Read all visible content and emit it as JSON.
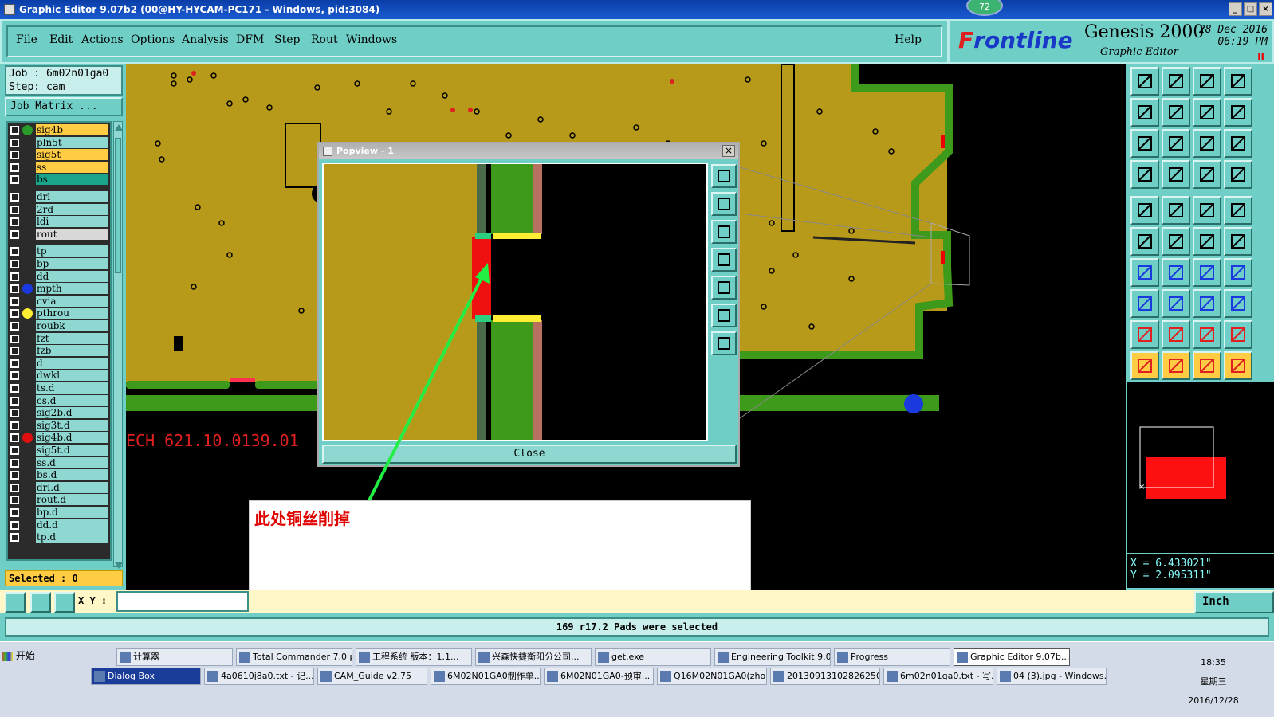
{
  "window": {
    "title": "Graphic Editor 9.07b2 (00@HY-HYCAM-PC171 - Windows, pid:3084)",
    "badge": "72",
    "controls": [
      "_",
      "□",
      "×"
    ]
  },
  "menu": {
    "items": [
      "File",
      "Edit",
      "Actions",
      "Options",
      "Analysis",
      "DFM",
      "Step",
      "Rout",
      "Windows"
    ],
    "help": "Help"
  },
  "brand": {
    "logo_prefix": "F",
    "logo_main": "rontline",
    "product": "Genesis 2000",
    "subtitle": "Graphic Editor",
    "date_line1": "28 Dec 2016",
    "date_line2": "06:19 PM",
    "pause": "II"
  },
  "job": {
    "job_line": "Job : 6m02n01ga0",
    "step_line": "Step: cam",
    "matrix_button": "Job Matrix ...",
    "selected": "Selected : 0"
  },
  "layers": [
    {
      "name": "sig4b",
      "color": "#ffcc44",
      "dot": "#2a9a2a"
    },
    {
      "name": "pln5t",
      "color": "#8fd8d2",
      "dot": ""
    },
    {
      "name": "sig5t",
      "color": "#ffcc44",
      "dot": ""
    },
    {
      "name": "ss",
      "color": "#ffcc44",
      "dot": ""
    },
    {
      "name": "bs",
      "color": "#1aa58a",
      "dot": ""
    },
    {
      "name": "drl",
      "color": "#8fd8d2",
      "dot": ""
    },
    {
      "name": "2rd",
      "color": "#8fd8d2",
      "dot": ""
    },
    {
      "name": "ldi",
      "color": "#8fd8d2",
      "dot": ""
    },
    {
      "name": "rout",
      "color": "#d8d8d8",
      "dot": ""
    },
    {
      "name": "tp",
      "color": "#8fd8d2",
      "dot": ""
    },
    {
      "name": "bp",
      "color": "#8fd8d2",
      "dot": ""
    },
    {
      "name": "dd",
      "color": "#8fd8d2",
      "dot": ""
    },
    {
      "name": "mpth",
      "color": "#8fd8d2",
      "dot": "#1a3ae0"
    },
    {
      "name": "cvia",
      "color": "#8fd8d2",
      "dot": ""
    },
    {
      "name": "pthrou",
      "color": "#8fd8d2",
      "dot": "#ffee33"
    },
    {
      "name": "roubk",
      "color": "#8fd8d2",
      "dot": ""
    },
    {
      "name": "fzt",
      "color": "#8fd8d2",
      "dot": ""
    },
    {
      "name": "fzb",
      "color": "#8fd8d2",
      "dot": ""
    },
    {
      "name": "d",
      "color": "#8fd8d2",
      "dot": ""
    },
    {
      "name": "dwkl",
      "color": "#8fd8d2",
      "dot": ""
    },
    {
      "name": "ts.d",
      "color": "#8fd8d2",
      "dot": ""
    },
    {
      "name": "cs.d",
      "color": "#8fd8d2",
      "dot": ""
    },
    {
      "name": "sig2b.d",
      "color": "#8fd8d2",
      "dot": ""
    },
    {
      "name": "sig3t.d",
      "color": "#8fd8d2",
      "dot": ""
    },
    {
      "name": "sig4b.d",
      "color": "#8fd8d2",
      "dot": "#e01010"
    },
    {
      "name": "sig5t.d",
      "color": "#8fd8d2",
      "dot": ""
    },
    {
      "name": "ss.d",
      "color": "#8fd8d2",
      "dot": ""
    },
    {
      "name": "bs.d",
      "color": "#8fd8d2",
      "dot": ""
    },
    {
      "name": "drl.d",
      "color": "#8fd8d2",
      "dot": ""
    },
    {
      "name": "rout.d",
      "color": "#8fd8d2",
      "dot": ""
    },
    {
      "name": "bp.d",
      "color": "#8fd8d2",
      "dot": ""
    },
    {
      "name": "dd.d",
      "color": "#8fd8d2",
      "dot": ""
    },
    {
      "name": "tp.d",
      "color": "#8fd8d2",
      "dot": ""
    }
  ],
  "canvas": {
    "board_text": "ECH  621.10.0139.01"
  },
  "popup": {
    "title": "Popview - 1",
    "close_x": "×",
    "close_button": "Close"
  },
  "note": {
    "text": "此处铜丝削掉"
  },
  "coords": {
    "x": "X = 6.433021\"",
    "y": "Y = 2.095311\""
  },
  "bottom": {
    "xy_label": "X Y :",
    "xy_value": "",
    "units": "Inch",
    "status": "169 r17.2 Pads were selected"
  },
  "taskbar": {
    "start": "开始",
    "row1": [
      "计算器",
      "Total Commander 7.0 p...",
      "工程系统  版本：1.1...",
      "兴森快捷衡阳分公司...",
      "get.exe",
      "Engineering Toolkit 9.0...",
      "Progress",
      "Graphic Editor 9.07b..."
    ],
    "row2": [
      "Dialog Box",
      "4a0610j8a0.txt - 记...",
      "CAM_Guide v2.75",
      "6M02N01GA0制作单...",
      "6M02N01GA0-预审...",
      "Q16M02N01GA0(zho...",
      "20130913102826250...",
      "6m02n01ga0.txt - 写...",
      "04 (3).jpg - Windows..."
    ],
    "time": "18:35",
    "weekday": "星期三",
    "date": "2016/12/28"
  }
}
